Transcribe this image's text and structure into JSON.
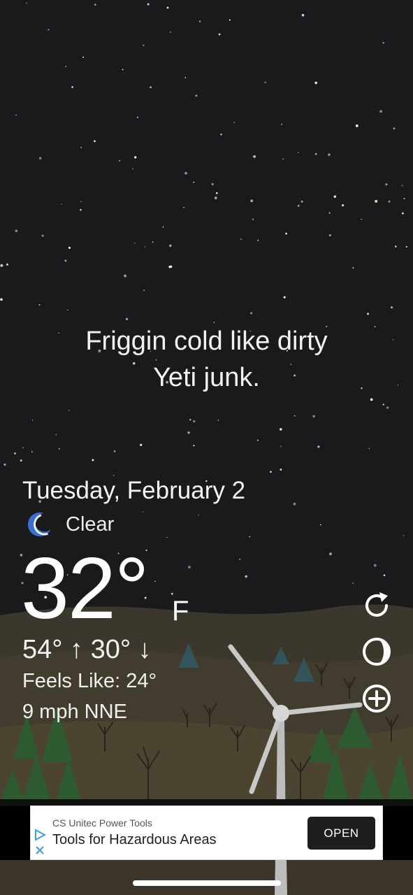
{
  "quip": {
    "line1": "Friggin cold like dirty",
    "line2": "Yeti junk."
  },
  "weather": {
    "date": "Tuesday, February 2",
    "condition": "Clear",
    "condition_icon": "moon-icon",
    "temperature": "32°",
    "unit": "F",
    "high": "54°",
    "low": "30°",
    "feels_like": "Feels Like: 24°",
    "wind": "9 mph NNE"
  },
  "actions": {
    "refresh_icon": "refresh-icon",
    "theme_icon": "moon-phase-icon",
    "add_icon": "plus-circle-icon"
  },
  "ad": {
    "provider": "CS Unitec Power Tools",
    "headline": "Tools for Hazardous Areas",
    "cta": "OPEN",
    "play_icon": "ad-choices-icon",
    "close_icon": "close-icon"
  },
  "colors": {
    "sky": "#1a1a1c",
    "hill_far": "#3e3a2f",
    "hill_near": "#4a4330",
    "tree_green": "#2c5a2c",
    "moon": "#3b6fd6"
  }
}
